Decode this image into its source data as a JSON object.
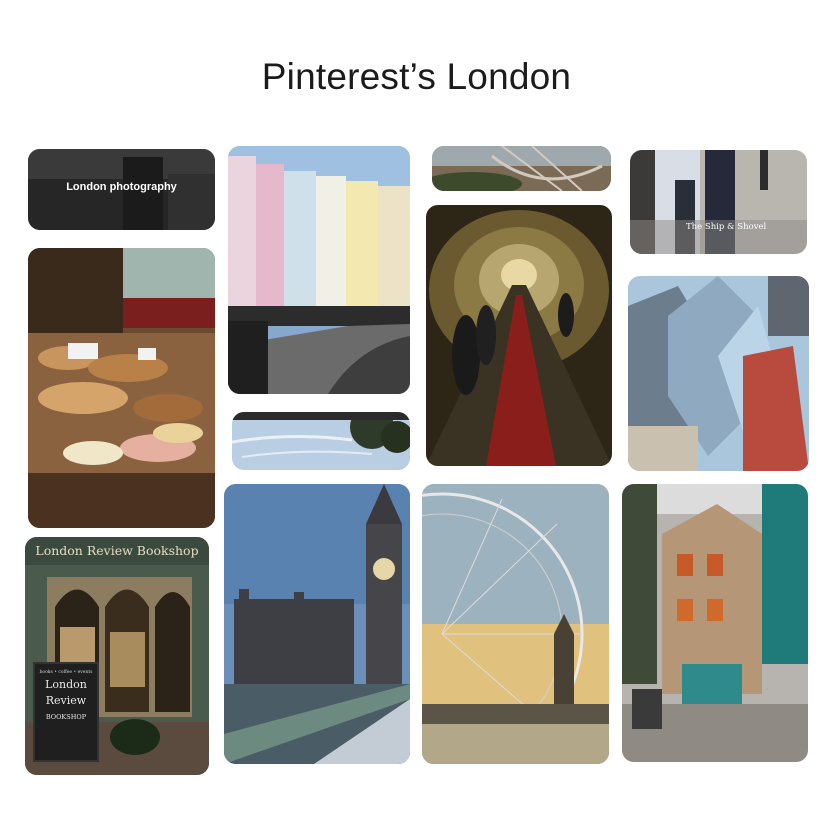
{
  "board": {
    "title": "Pinterest’s London"
  },
  "pins": [
    {
      "id": "london-photography",
      "overlay": "London photography"
    },
    {
      "id": "ship-shovel",
      "tag": "The Ship & Shovel"
    },
    {
      "id": "bookshop",
      "sign": "London Review Bookshop",
      "aboard": {
        "top_line": "books • coffee • events",
        "title_line1": "London",
        "title_line2": "Review",
        "bottom": "BOOKSHOP"
      }
    }
  ],
  "colors": {
    "title": "#1b1b1b",
    "background": "#ffffff"
  }
}
